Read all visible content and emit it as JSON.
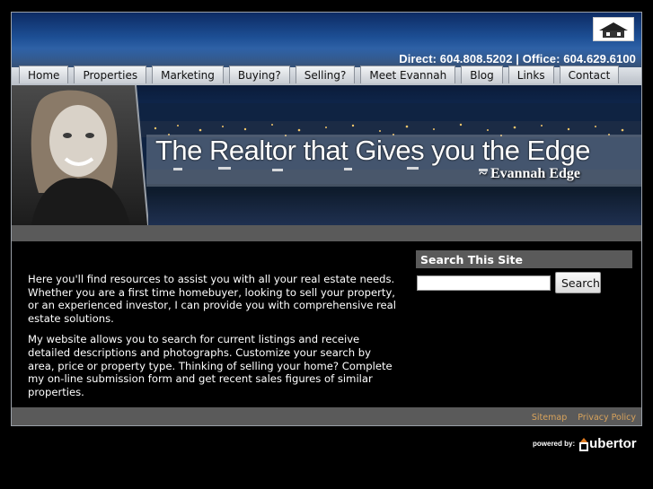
{
  "header": {
    "contact_line": "Direct: 604.808.5202 | Office: 604.629.6100"
  },
  "nav": {
    "items": [
      "Home",
      "Properties",
      "Marketing",
      "Buying?",
      "Selling?",
      "Meet Evannah",
      "Blog",
      "Links",
      "Contact"
    ]
  },
  "hero": {
    "tagline": "The Realtor that Gives you the Edge",
    "signature": "~ Evannah Edge"
  },
  "main": {
    "paragraphs": [
      "Here you'll find resources to assist you with all your real estate needs. Whether you are a first time homebuyer, looking to sell your property, or an experienced investor, I can provide you with comprehensive real estate solutions.",
      "My website allows you to search for current listings and receive detailed descriptions and photographs. Customize your search by area, price or property type. Thinking of selling your home? Complete my on-line submission form and get recent sales figures of similar properties."
    ]
  },
  "sidebar": {
    "title": "Search This Site",
    "search_value": "",
    "search_button": "Search"
  },
  "footer": {
    "links": [
      "Sitemap",
      "Privacy Policy"
    ]
  },
  "powered": {
    "label": "powered by:",
    "brand": "ubertor"
  },
  "colors": {
    "footer_link": "#d8a35c",
    "bar_gray": "#5a5a5a",
    "brand_accent": "#e07a1f"
  },
  "icons": {
    "logo": "brokerage-logo-icon",
    "portrait": "realtor-portrait-image"
  }
}
